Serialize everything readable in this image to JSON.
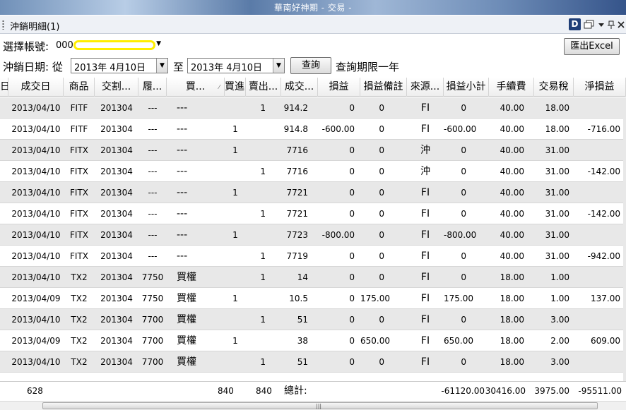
{
  "window": {
    "title": "華南好神期 - 交易 -"
  },
  "panel": {
    "title": "沖銷明細(1)",
    "d_label": "D"
  },
  "toolbar": {
    "account_label": "選擇帳號:",
    "account_prefix": "000-",
    "date_label": "沖銷日期: 從",
    "date_from": "2013年  4月10日",
    "to_label": "至",
    "date_to": "2013年  4月10日",
    "query_button": "查詢",
    "limit_note": "查詢期限一年",
    "export_button": "匯出Excel"
  },
  "columns": [
    "日",
    "成交日",
    "商品",
    "交割...",
    "履...",
    "買...",
    "買進...",
    "賣出...",
    "成交...",
    "損益",
    "損益備註",
    "來源...",
    "損益小計",
    "手續費",
    "交易稅",
    "淨損益"
  ],
  "rows": [
    [
      "2013/04/10",
      "FITF",
      "201304",
      "---",
      "---",
      "",
      "1",
      "914.2",
      "0",
      "0",
      "FI",
      "0",
      "40.00",
      "18.00",
      ""
    ],
    [
      "2013/04/10",
      "FITF",
      "201304",
      "---",
      "---",
      "1",
      "",
      "914.8",
      "-600.00",
      "0",
      "FI",
      "-600.00",
      "40.00",
      "18.00",
      "-716.00"
    ],
    [
      "2013/04/10",
      "FITX",
      "201304",
      "---",
      "---",
      "1",
      "",
      "7716",
      "0",
      "0",
      "沖",
      "0",
      "40.00",
      "31.00",
      ""
    ],
    [
      "2013/04/10",
      "FITX",
      "201304",
      "---",
      "---",
      "",
      "1",
      "7716",
      "0",
      "0",
      "沖",
      "0",
      "40.00",
      "31.00",
      "-142.00"
    ],
    [
      "2013/04/10",
      "FITX",
      "201304",
      "---",
      "---",
      "1",
      "",
      "7721",
      "0",
      "0",
      "FI",
      "0",
      "40.00",
      "31.00",
      ""
    ],
    [
      "2013/04/10",
      "FITX",
      "201304",
      "---",
      "---",
      "",
      "1",
      "7721",
      "0",
      "0",
      "FI",
      "0",
      "40.00",
      "31.00",
      "-142.00"
    ],
    [
      "2013/04/10",
      "FITX",
      "201304",
      "---",
      "---",
      "1",
      "",
      "7723",
      "-800.00",
      "0",
      "FI",
      "-800.00",
      "40.00",
      "31.00",
      ""
    ],
    [
      "2013/04/10",
      "FITX",
      "201304",
      "---",
      "---",
      "",
      "1",
      "7719",
      "0",
      "0",
      "FI",
      "0",
      "40.00",
      "31.00",
      "-942.00"
    ],
    [
      "2013/04/10",
      "TX2",
      "201304",
      "7750",
      "買權",
      "",
      "1",
      "14",
      "0",
      "0",
      "FI",
      "0",
      "18.00",
      "1.00",
      ""
    ],
    [
      "2013/04/09",
      "TX2",
      "201304",
      "7750",
      "買權",
      "1",
      "",
      "10.5",
      "0",
      "175.00",
      "FI",
      "175.00",
      "18.00",
      "1.00",
      "137.00"
    ],
    [
      "2013/04/10",
      "TX2",
      "201304",
      "7700",
      "買權",
      "",
      "1",
      "51",
      "0",
      "0",
      "FI",
      "0",
      "18.00",
      "3.00",
      ""
    ],
    [
      "2013/04/09",
      "TX2",
      "201304",
      "7700",
      "買權",
      "1",
      "",
      "38",
      "0",
      "650.00",
      "FI",
      "650.00",
      "18.00",
      "2.00",
      "609.00"
    ],
    [
      "2013/04/10",
      "TX2",
      "201304",
      "7700",
      "買權",
      "",
      "1",
      "51",
      "0",
      "0",
      "FI",
      "0",
      "18.00",
      "3.00",
      ""
    ]
  ],
  "summary": {
    "count": "628",
    "buy_total": "840",
    "sell_total": "840",
    "total_label": "總計:",
    "pl_subtotal": "-61120.00",
    "fee_total": "30416.00",
    "tax_total": "3975.00",
    "net_total": "-95511.00"
  }
}
